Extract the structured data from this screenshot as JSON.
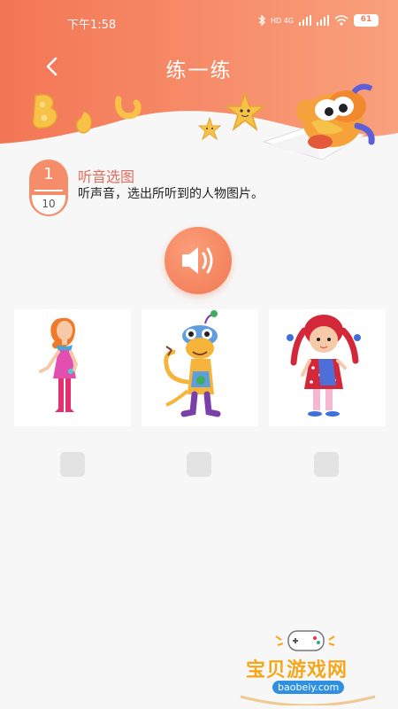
{
  "status_bar": {
    "time": "下午1:58",
    "network": "HD 4G",
    "battery": "61"
  },
  "header": {
    "title": "练一练"
  },
  "question": {
    "current": "1",
    "total": "10",
    "type_title": "听音选图",
    "instruction": "听声音，选出所听到的人物图片。"
  },
  "options": [
    {
      "name": "girl-in-pink-dress"
    },
    {
      "name": "cartoon-monster"
    },
    {
      "name": "girl-with-red-braids"
    }
  ],
  "watermark": {
    "title": "宝贝游戏网",
    "url": "baobeiy.com"
  },
  "colors": {
    "header_gradient_start": "#f47c58",
    "header_gradient_end": "#f9a37d",
    "accent": "#f58d6b",
    "title_red": "#e86a5a"
  }
}
